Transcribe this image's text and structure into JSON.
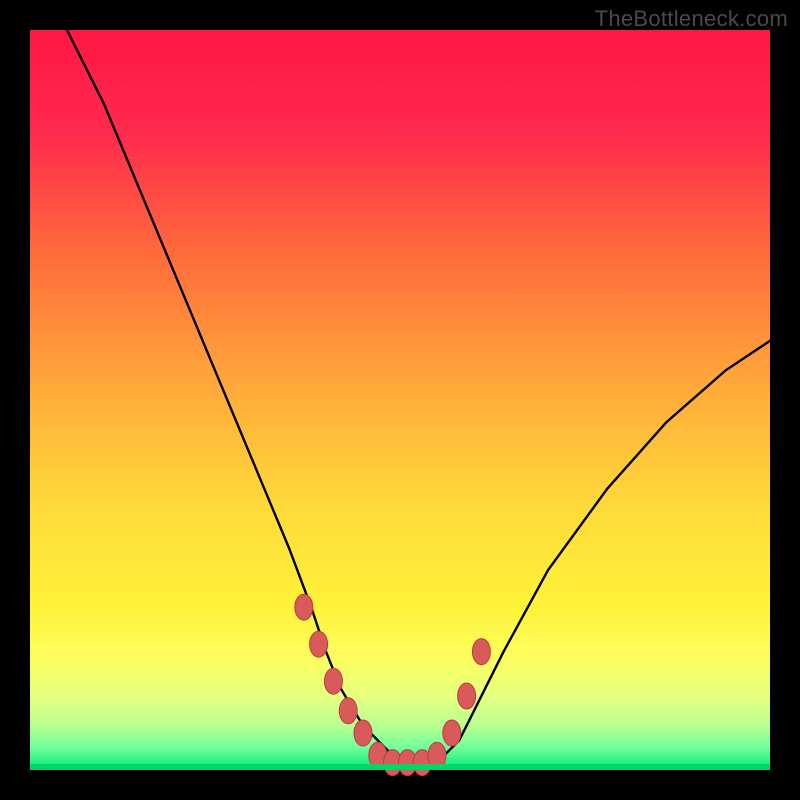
{
  "watermark": "TheBottleneck.com",
  "colors": {
    "frame_bg": "#000000",
    "gradient_stops": [
      {
        "pos": 0,
        "color": "#ff1744"
      },
      {
        "pos": 14,
        "color": "#ff2a4d"
      },
      {
        "pos": 30,
        "color": "#ff6a3c"
      },
      {
        "pos": 48,
        "color": "#ffa93a"
      },
      {
        "pos": 64,
        "color": "#ffd93a"
      },
      {
        "pos": 78,
        "color": "#fff23a"
      },
      {
        "pos": 85,
        "color": "#fdff60"
      },
      {
        "pos": 90,
        "color": "#e6ff80"
      },
      {
        "pos": 94,
        "color": "#b8ff90"
      },
      {
        "pos": 97,
        "color": "#70ff9a"
      },
      {
        "pos": 100,
        "color": "#00e67a"
      }
    ],
    "curve_stroke": "#000000",
    "marker_fill": "#d95a5a",
    "marker_stroke": "#b83f3f",
    "bottom_accent": "#00d666"
  },
  "chart_data": {
    "type": "line",
    "title": "",
    "xlabel": "",
    "ylabel": "",
    "xlim": [
      0,
      100
    ],
    "ylim": [
      0,
      100
    ],
    "grid": false,
    "legend": false,
    "series": [
      {
        "name": "bottleneck-curve",
        "x": [
          5,
          10,
          15,
          20,
          25,
          30,
          35,
          38,
          40,
          42,
          45,
          48,
          50,
          52,
          54,
          56,
          58,
          60,
          64,
          70,
          78,
          86,
          94,
          100
        ],
        "y": [
          100,
          90,
          78,
          66,
          54,
          42,
          30,
          22,
          16,
          11,
          6,
          3,
          1,
          1,
          1,
          2,
          4,
          8,
          16,
          27,
          38,
          47,
          54,
          58
        ]
      }
    ],
    "markers": {
      "name": "highlight-points",
      "x": [
        37,
        39,
        41,
        43,
        45,
        47,
        49,
        51,
        53,
        55,
        57,
        59,
        61
      ],
      "y": [
        22,
        17,
        12,
        8,
        5,
        2,
        1,
        1,
        1,
        2,
        5,
        10,
        16
      ]
    }
  }
}
